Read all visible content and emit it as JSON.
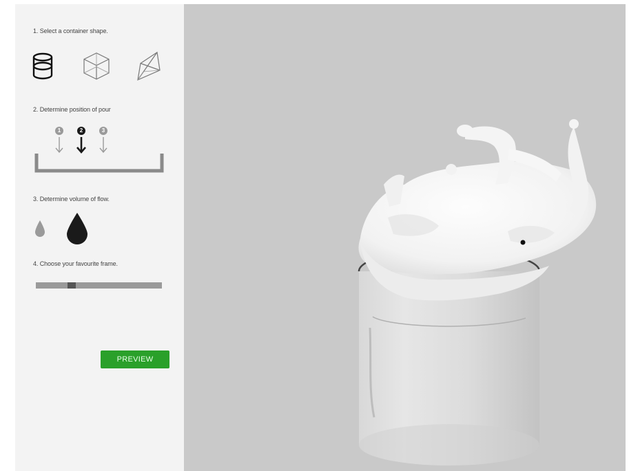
{
  "steps": {
    "shape_label": "1. Select a container shape.",
    "pour_label": "2. Determine position of pour",
    "volume_label": "3. Determine volume of flow.",
    "frame_label": "4. Choose your favourite frame."
  },
  "shapes": [
    {
      "name": "cylinder",
      "icon": "cylinder-icon",
      "selected": true
    },
    {
      "name": "cube",
      "icon": "cube-icon",
      "selected": false
    },
    {
      "name": "wedge",
      "icon": "wedge-icon",
      "selected": false
    }
  ],
  "pour_positions": [
    {
      "number": "1",
      "selected": false
    },
    {
      "number": "2",
      "selected": true
    },
    {
      "number": "3",
      "selected": false
    }
  ],
  "volumes": [
    {
      "name": "low",
      "icon": "small-drop-icon",
      "selected": false
    },
    {
      "name": "high",
      "icon": "large-drop-icon",
      "selected": true
    }
  ],
  "frame_slider": {
    "fraction": 0.27
  },
  "preview_label": "PREVIEW",
  "colors": {
    "accent": "#2aa02a",
    "panel": "#f3f3f3",
    "viewport": "#c9c9c9",
    "selected": "#1a1a1a",
    "unselected": "#9a9a9a"
  }
}
